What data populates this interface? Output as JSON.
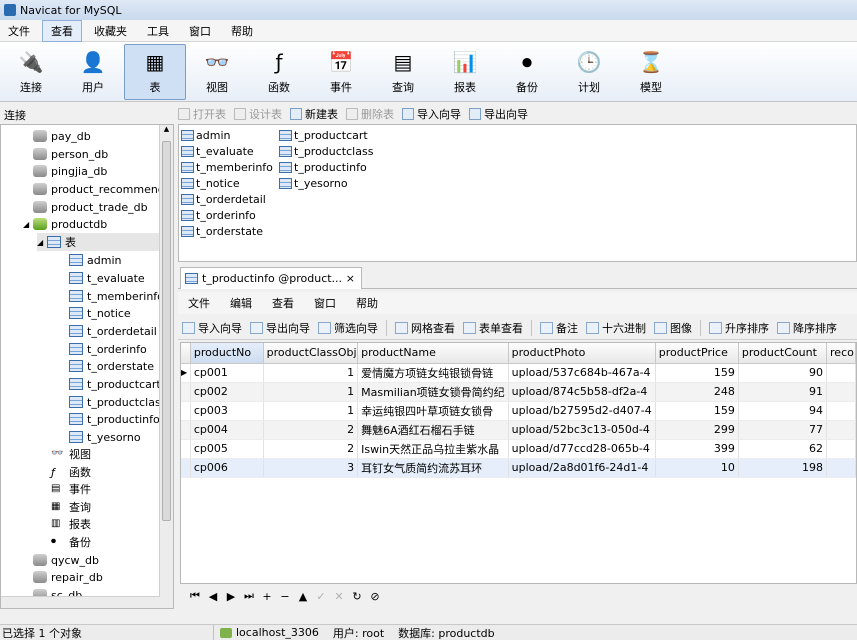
{
  "window": {
    "title": "Navicat for MySQL"
  },
  "menu": [
    "文件",
    "查看",
    "收藏夹",
    "工具",
    "窗口",
    "帮助"
  ],
  "toolbar": [
    {
      "label": "连接",
      "icon": "connection-icon"
    },
    {
      "label": "用户",
      "icon": "user-icon"
    },
    {
      "label": "表",
      "icon": "table-icon"
    },
    {
      "label": "视图",
      "icon": "view-icon"
    },
    {
      "label": "函数",
      "icon": "function-icon"
    },
    {
      "label": "事件",
      "icon": "event-icon"
    },
    {
      "label": "查询",
      "icon": "query-icon"
    },
    {
      "label": "报表",
      "icon": "report-icon"
    },
    {
      "label": "备份",
      "icon": "backup-icon"
    },
    {
      "label": "计划",
      "icon": "schedule-icon"
    },
    {
      "label": "模型",
      "icon": "model-icon"
    }
  ],
  "connection_header": "连接",
  "tree": {
    "databases_top": [
      "pay_db",
      "person_db",
      "pingjia_db",
      "product_recommend",
      "product_trade_db"
    ],
    "open_db": "productdb",
    "tables_label": "表",
    "tables": [
      "admin",
      "t_evaluate",
      "t_memberinfo",
      "t_notice",
      "t_orderdetail",
      "t_orderinfo",
      "t_orderstate",
      "t_productcart",
      "t_productclass",
      "t_productinfo",
      "t_yesorno"
    ],
    "others": [
      "视图",
      "函数",
      "事件",
      "查询",
      "报表",
      "备份"
    ],
    "databases_bottom": [
      "qycw_db",
      "repair_db",
      "sc_db"
    ]
  },
  "object_toolbar": [
    {
      "label": "打开表",
      "enabled": false
    },
    {
      "label": "设计表",
      "enabled": false
    },
    {
      "label": "新建表",
      "enabled": true
    },
    {
      "label": "删除表",
      "enabled": false
    },
    {
      "label": "导入向导",
      "enabled": true
    },
    {
      "label": "导出向导",
      "enabled": true
    }
  ],
  "object_list": {
    "col1": [
      "admin",
      "t_evaluate",
      "t_memberinfo",
      "t_notice",
      "t_orderdetail",
      "t_orderinfo",
      "t_orderstate"
    ],
    "col2": [
      "t_productcart",
      "t_productclass",
      "t_productinfo",
      "t_yesorno"
    ]
  },
  "tab": {
    "label": "t_productinfo @product...",
    "close": "×"
  },
  "inner_menu": [
    "文件",
    "编辑",
    "查看",
    "窗口",
    "帮助"
  ],
  "data_toolbar": [
    "导入向导",
    "导出向导",
    "筛选向导",
    "网格查看",
    "表单查看",
    "备注",
    "十六进制",
    "图像",
    "升序排序",
    "降序排序"
  ],
  "grid": {
    "columns": [
      "productNo",
      "productClassObj",
      "productName",
      "productPhoto",
      "productPrice",
      "productCount",
      "reco"
    ],
    "rows": [
      [
        "cp001",
        "1",
        "爱情魔方项链女纯银锁骨链",
        "upload/537c684b-467a-4",
        "159",
        "90"
      ],
      [
        "cp002",
        "1",
        "Masmilian项链女锁骨简约纪",
        "upload/874c5b58-df2a-4",
        "248",
        "91"
      ],
      [
        "cp003",
        "1",
        "幸运纯银四叶草项链女锁骨",
        "upload/b27595d2-d407-4",
        "159",
        "94"
      ],
      [
        "cp004",
        "2",
        "舞魅6A酒红石榴石手链",
        "upload/52bc3c13-050d-4",
        "299",
        "77"
      ],
      [
        "cp005",
        "2",
        "Iswin天然正品乌拉圭紫水晶",
        "upload/d77ccd28-065b-4",
        "399",
        "62"
      ],
      [
        "cp006",
        "3",
        "耳钉女气质简约流苏耳环",
        "upload/2a8d01f6-24d1-4",
        "10",
        "198"
      ]
    ]
  },
  "navbar": [
    "⏮",
    "◀",
    "▶",
    "⏭",
    "+",
    "−",
    "▲",
    "✓",
    "✕",
    "↻",
    "⊘"
  ],
  "status": {
    "selection": "已选择 1 个对象",
    "host": "localhost_3306",
    "user": "用户: root",
    "db": "数据库: productdb"
  }
}
